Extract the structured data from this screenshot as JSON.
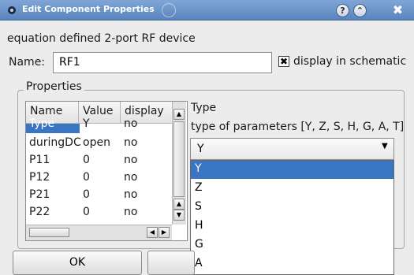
{
  "window": {
    "title": "Edit Component Properties"
  },
  "titlebar_buttons": {
    "help": "?",
    "shade": "⌃",
    "close": "✖"
  },
  "description": "equation defined 2-port RF device",
  "name_label": "Name:",
  "name_value": "RF1",
  "display_checkbox": {
    "label": "display in schematic",
    "checked": true,
    "mark": "✖"
  },
  "properties": {
    "title": "Properties",
    "columns": [
      "Name",
      "Value",
      "display"
    ],
    "partial_row": {
      "name": "Type",
      "value": "Y",
      "display": "no"
    },
    "rows": [
      {
        "name": "duringDC",
        "value": "open",
        "display": "no"
      },
      {
        "name": "P11",
        "value": "0",
        "display": "no"
      },
      {
        "name": "P12",
        "value": "0",
        "display": "no"
      },
      {
        "name": "P21",
        "value": "0",
        "display": "no"
      },
      {
        "name": "P22",
        "value": "0",
        "display": "no"
      }
    ]
  },
  "editor": {
    "heading": "Type",
    "description": "type of parameters [Y, Z, S, H, G, A, T]",
    "selected": "Y",
    "options": [
      "Y",
      "Z",
      "S",
      "H",
      "G",
      "A"
    ]
  },
  "buttons": {
    "ok": "OK"
  },
  "colors": {
    "titlebar": "#6a93c9",
    "selection": "#3a75c4"
  }
}
